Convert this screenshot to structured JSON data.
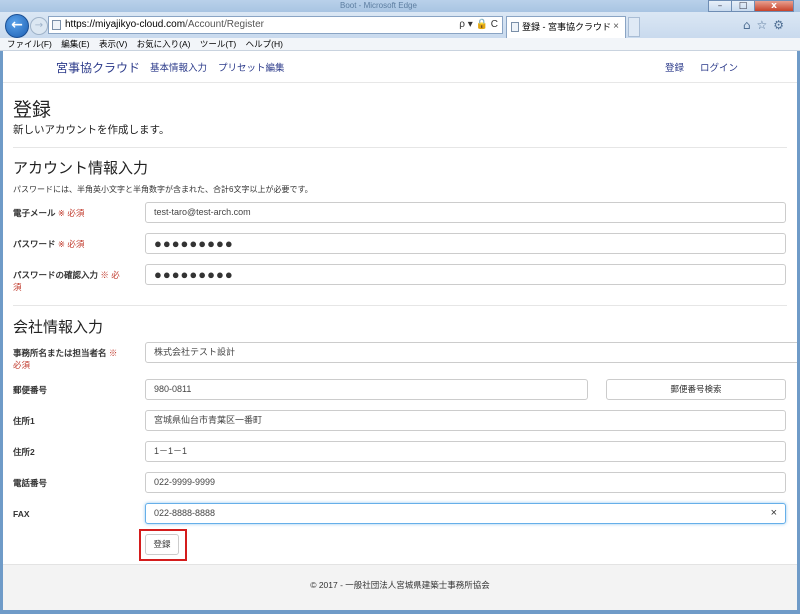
{
  "browser": {
    "window_title": "Boot - Microsoft Edge",
    "url_main": "https://miyajikyo-cloud.com",
    "url_path": "/Account/Register",
    "addr_controls": "ρ ▾ 🔒 C",
    "tab_title": "登録 - 宮事協クラウド",
    "tab_close": "×",
    "menu": [
      "ファイル(F)",
      "編集(E)",
      "表示(V)",
      "お気に入り(A)",
      "ツール(T)",
      "ヘルプ(H)"
    ],
    "right_icons": "⌂☆⚙"
  },
  "nav": {
    "brand": "宮事協クラウド",
    "links": [
      "基本情報入力",
      "プリセット編集"
    ],
    "right": [
      "登録",
      "ログイン"
    ]
  },
  "page": {
    "title": "登録",
    "subtitle": "新しいアカウントを作成します。"
  },
  "account": {
    "heading": "アカウント情報入力",
    "hint": "パスワードには、半角英小文字と半角数字が含まれた、合計6文字以上が必要です。",
    "email_label": "電子メール",
    "password_label": "パスワード",
    "confirm_label": "パスワードの確認入力",
    "required": "※ 必須",
    "email_value": "test-taro@test-arch.com",
    "password_mask": "●●●●●●●●●",
    "confirm_mask": "●●●●●●●●●"
  },
  "company": {
    "heading": "会社情報入力",
    "name_label": "事務所名または担当者名",
    "required": "※ 必須",
    "name_value": "株式会社テスト設計",
    "zip_label": "郵便番号",
    "zip_value": "980-0811",
    "zip_search_button": "郵便番号検索",
    "addr1_label": "住所1",
    "addr1_value": "宮城県仙台市青葉区一番町",
    "addr2_label": "住所2",
    "addr2_value": "1－1－1",
    "tel_label": "電話番号",
    "tel_value": "022-9999-9999",
    "fax_label": "FAX",
    "fax_value": "022-8888-8888",
    "clear": "×"
  },
  "submit_label": "登録",
  "footer": "© 2017 - 一般社団法人宮城県建築士事務所協会",
  "colors": {
    "accent": "#2b3a8a",
    "required": "#c0392b",
    "highlight": "#d41c1c"
  }
}
